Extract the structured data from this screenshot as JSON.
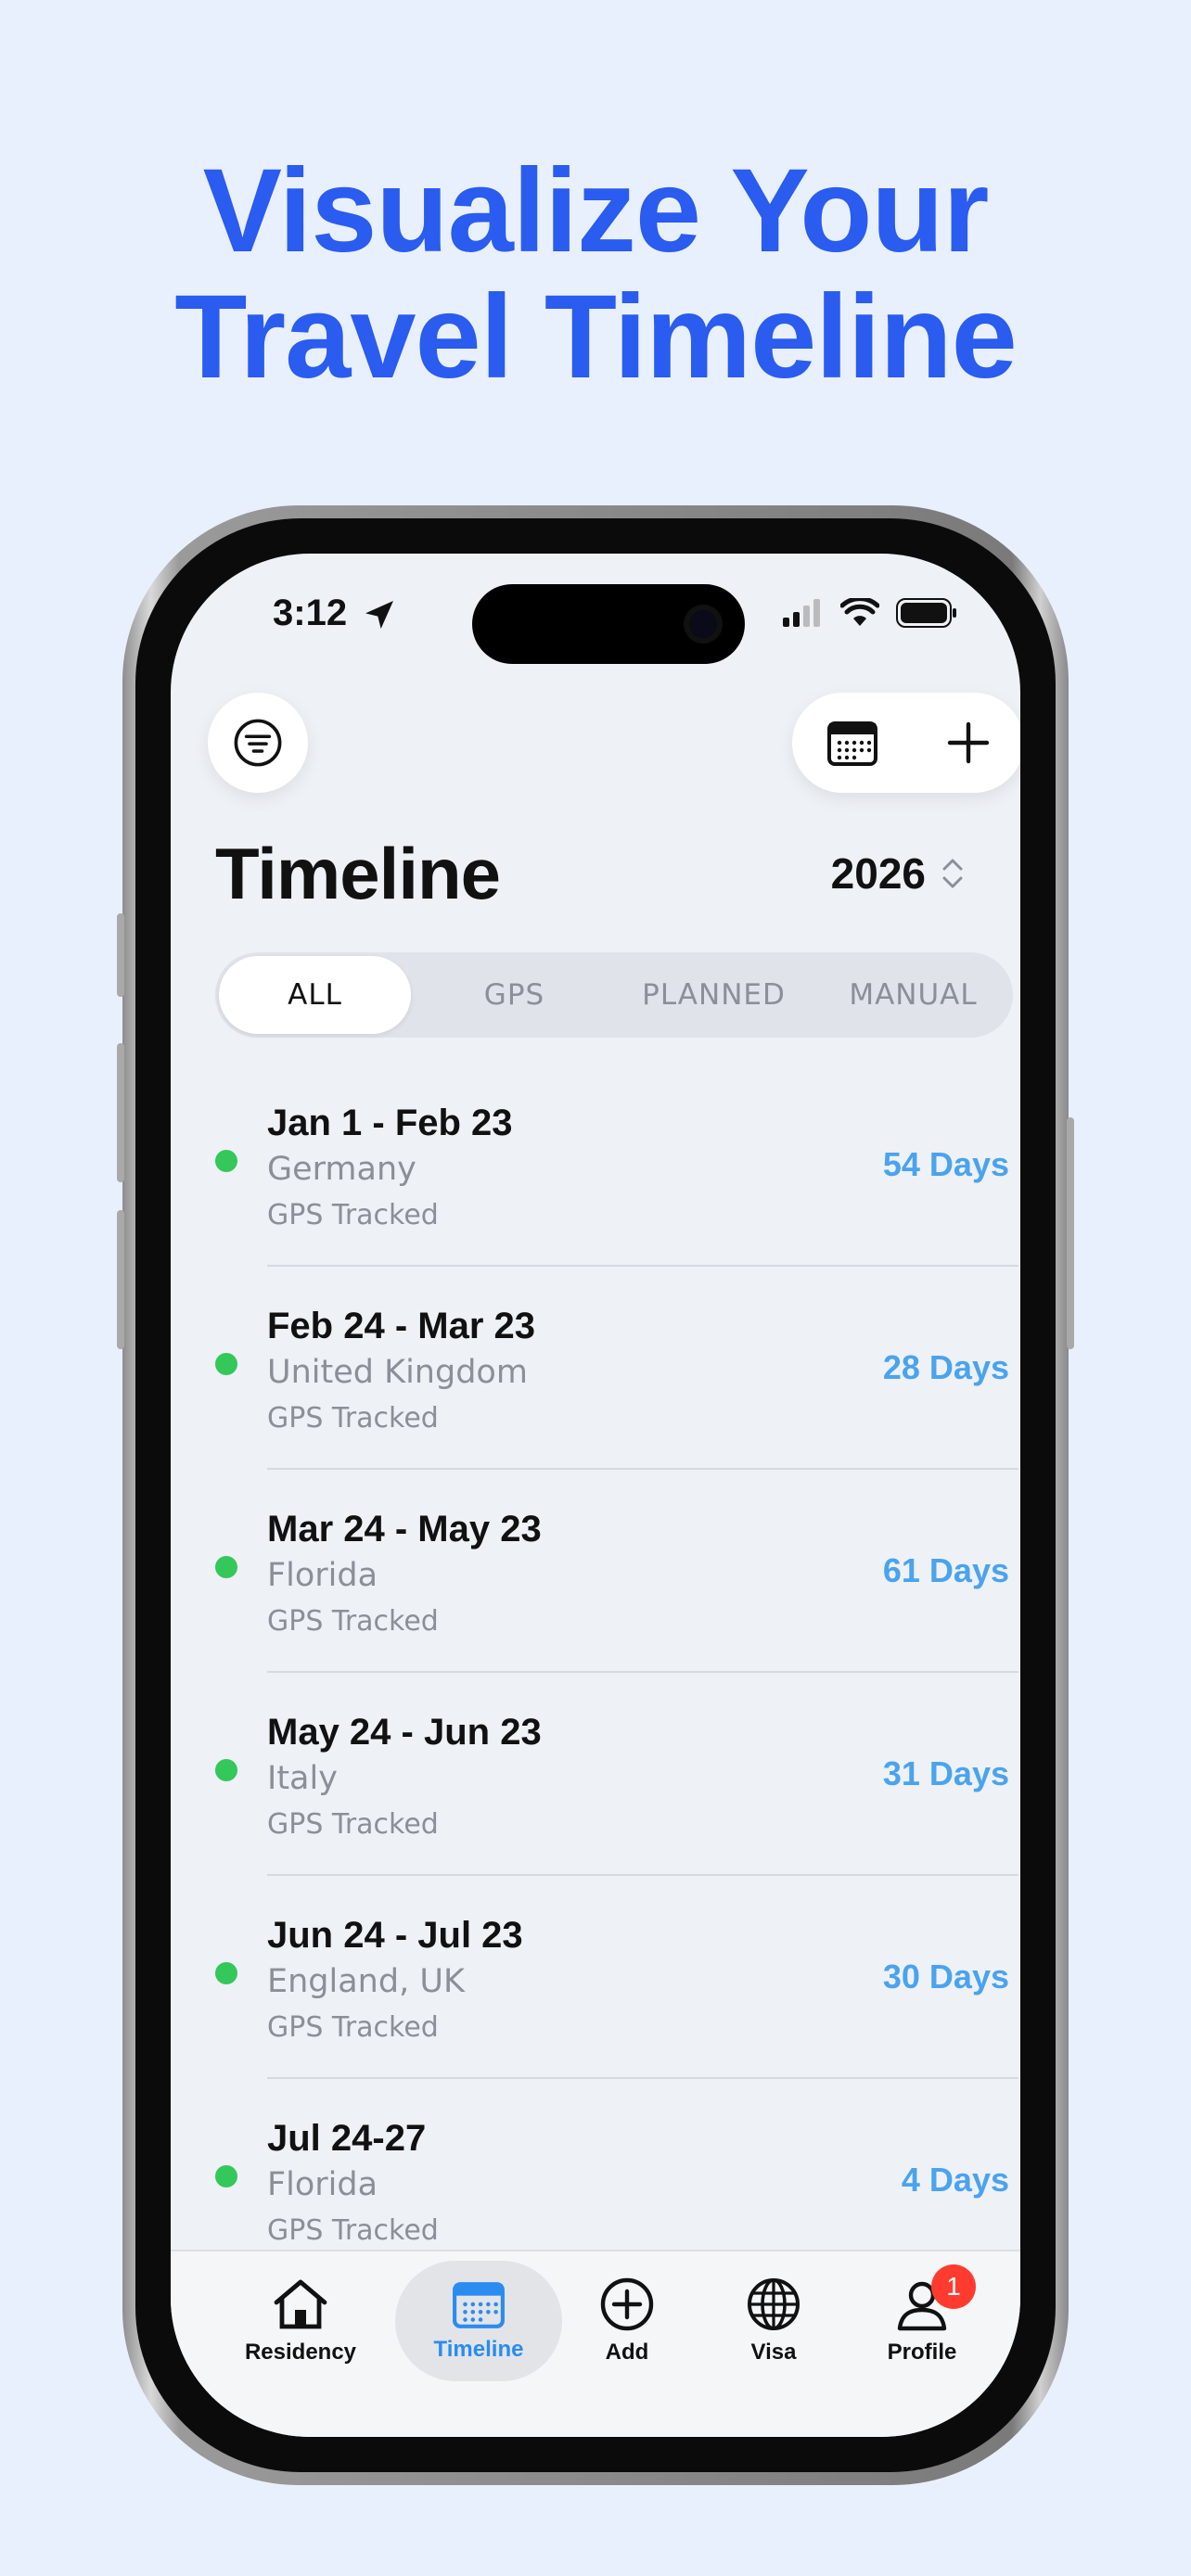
{
  "headline": {
    "line1": "Visualize Your",
    "line2": "Travel Timeline"
  },
  "status_bar": {
    "time": "3:12"
  },
  "page": {
    "title": "Timeline",
    "year": "2026"
  },
  "filters": [
    {
      "label": "ALL",
      "active": true
    },
    {
      "label": "GPS",
      "active": false
    },
    {
      "label": "PLANNED",
      "active": false
    },
    {
      "label": "MANUAL",
      "active": false
    }
  ],
  "entries": [
    {
      "range": "Jan 1 - Feb 23",
      "place": "Germany",
      "source": "GPS Tracked",
      "days": "54 Days"
    },
    {
      "range": "Feb 24 - Mar 23",
      "place": "United Kingdom",
      "source": "GPS Tracked",
      "days": "28 Days"
    },
    {
      "range": "Mar 24 - May 23",
      "place": "Florida",
      "source": "GPS Tracked",
      "days": "61 Days"
    },
    {
      "range": "May 24 - Jun 23",
      "place": "Italy",
      "source": "GPS Tracked",
      "days": "31 Days"
    },
    {
      "range": "Jun 24 - Jul 23",
      "place": "England, UK",
      "source": "GPS Tracked",
      "days": "30 Days"
    },
    {
      "range": "Jul 24-27",
      "place": "Florida",
      "source": "GPS Tracked",
      "days": "4 Days"
    }
  ],
  "tabbar": {
    "items": [
      {
        "label": "Residency",
        "icon": "house-icon"
      },
      {
        "label": "Timeline",
        "icon": "calendar-icon",
        "active": true
      },
      {
        "label": "Add",
        "icon": "plus-circle-icon"
      },
      {
        "label": "Visa",
        "icon": "globe-icon"
      },
      {
        "label": "Profile",
        "icon": "person-icon",
        "badge": "1"
      }
    ]
  },
  "colors": {
    "accent": "#2a5cf0",
    "days": "#4aa3ef",
    "gps_dot": "#34c759",
    "badge": "#ff3b30"
  }
}
